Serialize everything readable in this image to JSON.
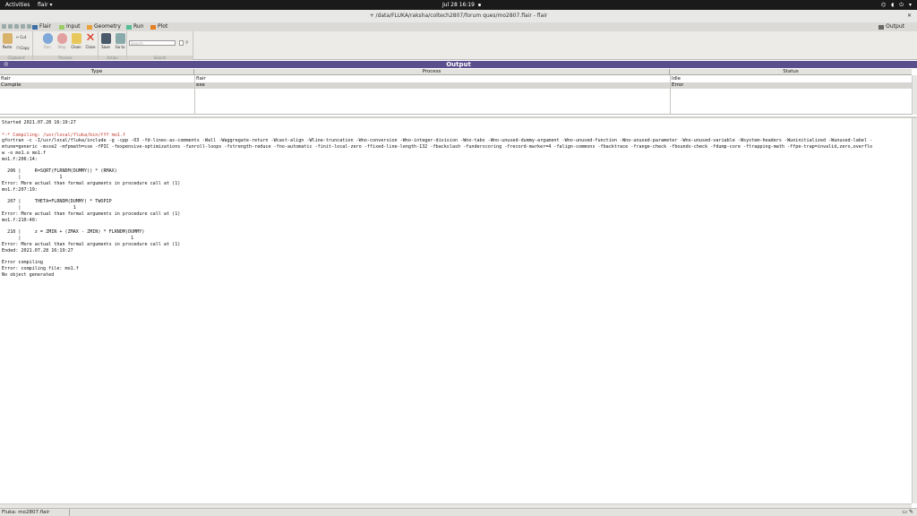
{
  "topbar": {
    "activities": "Activities",
    "app_menu": "flair ▾",
    "clock": "Jul 28  16:19"
  },
  "window": {
    "title": "+ /data/FLUKA/raksha/coltech2807/forum ques/mo2807.flair - flair"
  },
  "ribbon_tabs": {
    "flair": "Flair",
    "input": "Input",
    "geometry": "Geometry",
    "run": "Run",
    "plot": "Plot",
    "output": "Output"
  },
  "ribbon": {
    "paste": "Paste",
    "cut": "Cut",
    "copy": "Copy",
    "run": "Run",
    "stop": "Stop",
    "clean": "Clean",
    "close": "Close",
    "save": "Save",
    "goto": "Go to",
    "search_placeholder": "Search",
    "group_clipboard": "Clipboard",
    "group_process": "Process",
    "group_action": "Action",
    "group_search": "Search"
  },
  "output_panel": {
    "title": "Output",
    "columns": [
      "Type",
      "Process",
      "Status"
    ],
    "rows": [
      {
        "type": "flair",
        "process": "flair",
        "status": "Idle"
      },
      {
        "type": "Compile",
        "process": "exe",
        "status": "Error"
      }
    ]
  },
  "log_lines": [
    {
      "text": "Started 2021.07.28 16:19:27",
      "red": false
    },
    {
      "text": "",
      "red": false
    },
    {
      "text": "*-* Compiling: /usr/local/fluka/bin/fff mo1.f",
      "red": true
    },
    {
      "text": "gfortran -c -I/usr/local/fluka/include -g -cpp -O3 -fd-lines-as-comments -Wall -Waggregate-return -Wcast-align -Wline-truncation -Wno-conversion -Wno-integer-division -Wno-tabs -Wno-unused-dummy-argument -Wno-unused-function -Wno-unused-parameter -Wno-unused-variable -Wsystem-headers -Wuninitialized -Wunused-label -",
      "red": false
    },
    {
      "text": "mtune=generic -msse2 -mfpmath=sse -fPIC -fexpensive-optimizations -funroll-loops -fstrength-reduce -fno-automatic -finit-local-zero -ffixed-line-length-132 -fbackslash -funderscoring -frecord-marker=4 -falign-commons -fbacktrace -frange-check -fbounds-check -fdump-core -ftrapping-math -ffpe-trap=invalid,zero,overflo",
      "red": false
    },
    {
      "text": "w -o mo1.o mo1.f",
      "red": false
    },
    {
      "text": "mo1.f:206:14:",
      "red": false
    },
    {
      "text": "",
      "red": false
    },
    {
      "text": "  206 |     R=SQRT(FLRNDM(DUMMY)) * (RMAX)",
      "red": false
    },
    {
      "text": "      |              1",
      "red": false
    },
    {
      "text": "Error: More actual than formal arguments in procedure call at (1)",
      "red": false
    },
    {
      "text": "mo1.f:207:19:",
      "red": false
    },
    {
      "text": "",
      "red": false
    },
    {
      "text": "  207 |     THETA=FLRNDM(DUMMY) * TWOPIP",
      "red": false
    },
    {
      "text": "      |                   1",
      "red": false
    },
    {
      "text": "Error: More actual than formal arguments in procedure call at (1)",
      "red": false
    },
    {
      "text": "mo1.f:210:40:",
      "red": false
    },
    {
      "text": "",
      "red": false
    },
    {
      "text": "  210 |     z = ZMIN + (ZMAX - ZMIN) * FLRNDM(DUMMY)",
      "red": false
    },
    {
      "text": "      |                                        1",
      "red": false
    },
    {
      "text": "Error: More actual than formal arguments in procedure call at (1)",
      "red": false
    },
    {
      "text": "Ended: 2021.07.28 16:19:27",
      "red": false
    },
    {
      "text": "",
      "red": false
    },
    {
      "text": "Error compiling",
      "red": false
    },
    {
      "text": "Error: compiling file: mo1.f",
      "red": false
    },
    {
      "text": "No object generated",
      "red": false
    }
  ],
  "statusbar": {
    "text": "Fluka: mo2807.flair"
  },
  "colors": {
    "panel_header": "#5a4e8c",
    "log_red": "#c0392b",
    "selected_row": "#d8d6d2"
  }
}
